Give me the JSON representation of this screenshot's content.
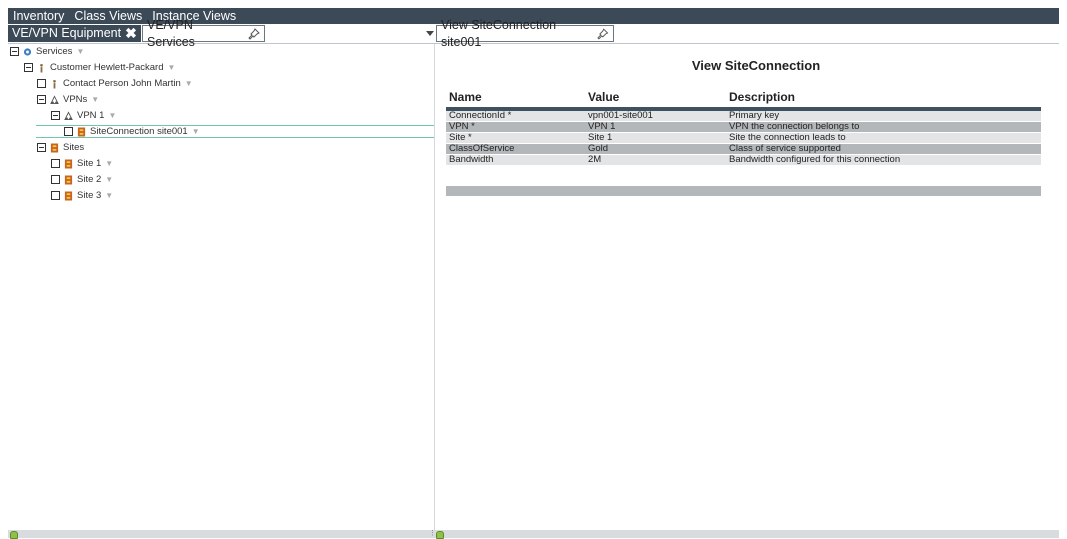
{
  "menu": [
    "Inventory",
    "Class Views",
    "Instance Views"
  ],
  "tabs": {
    "left_active": "VE/VPN Equipment",
    "left_second": "VE/VPN Services",
    "right": "View SiteConnection site001"
  },
  "tree": [
    {
      "label": "Services",
      "depth": 0,
      "icon": "services-icon"
    },
    {
      "label": "Customer Hewlett-Packard",
      "depth": 1,
      "icon": "person-icon"
    },
    {
      "label": "Contact Person John Martin",
      "depth": 2,
      "icon": "person-icon"
    },
    {
      "label": "VPNs",
      "depth": 2,
      "icon": "vpn-icon"
    },
    {
      "label": "VPN 1",
      "depth": 3,
      "icon": "vpn-icon"
    },
    {
      "label": "SiteConnection site001",
      "depth": 4,
      "icon": "site-icon",
      "selected": true
    },
    {
      "label": "Sites",
      "depth": 2,
      "icon": "site-icon"
    },
    {
      "label": "Site 1",
      "depth": 3,
      "icon": "site-icon"
    },
    {
      "label": "Site 2",
      "depth": 3,
      "icon": "site-icon"
    },
    {
      "label": "Site 3",
      "depth": 3,
      "icon": "site-icon"
    }
  ],
  "view": {
    "title": "View SiteConnection",
    "columns": [
      "Name",
      "Value",
      "Description"
    ],
    "rows": [
      [
        "ConnectionId *",
        "vpn001-site001",
        "Primary key"
      ],
      [
        "VPN *",
        "VPN 1",
        "VPN the connection belongs to"
      ],
      [
        "Site *",
        "Site 1",
        "Site the connection leads to"
      ],
      [
        "ClassOfService",
        "Gold",
        "Class of service supported"
      ],
      [
        "Bandwidth",
        "2M",
        "Bandwidth configured for this connection"
      ]
    ]
  },
  "colors": {
    "menubar": "#3c4a57",
    "selection_border": "#6fc6a8",
    "row_light": "#e2e4e6",
    "row_dark": "#b3b7ba"
  }
}
